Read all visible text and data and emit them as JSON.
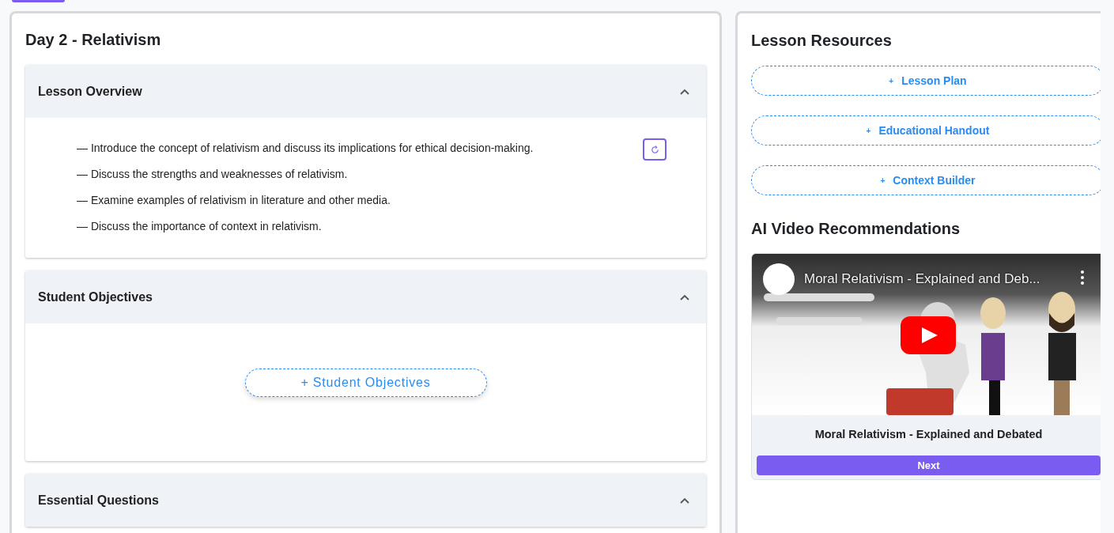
{
  "lesson": {
    "title": "Day 2 - Relativism",
    "sections": [
      {
        "title": "Lesson Overview",
        "expanded": true,
        "kind": "list",
        "items": [
          "— Introduce the concept of relativism and discuss its implications for ethical decision-making.",
          "— Discuss the strengths and weaknesses of relativism.",
          "— Examine examples of relativism in literature and other media.",
          "— Discuss the importance of context in relativism."
        ]
      },
      {
        "title": "Student Objectives",
        "expanded": true,
        "kind": "add",
        "add_label": "+ Student Objectives"
      },
      {
        "title": "Essential Questions",
        "expanded": true,
        "kind": "cut"
      }
    ]
  },
  "resources": {
    "title": "Lesson Resources",
    "buttons": [
      {
        "icon": "+",
        "label": "Lesson Plan"
      },
      {
        "icon": "+",
        "label": "Educational Handout"
      },
      {
        "icon": "+",
        "label": "Context Builder"
      }
    ]
  },
  "videos": {
    "title": "AI Video Recommendations",
    "video": {
      "overlay_title": "Moral Relativism - Explained and Deb...",
      "caption": "Moral Relativism - Explained and Debated"
    },
    "next_label": "Next"
  }
}
